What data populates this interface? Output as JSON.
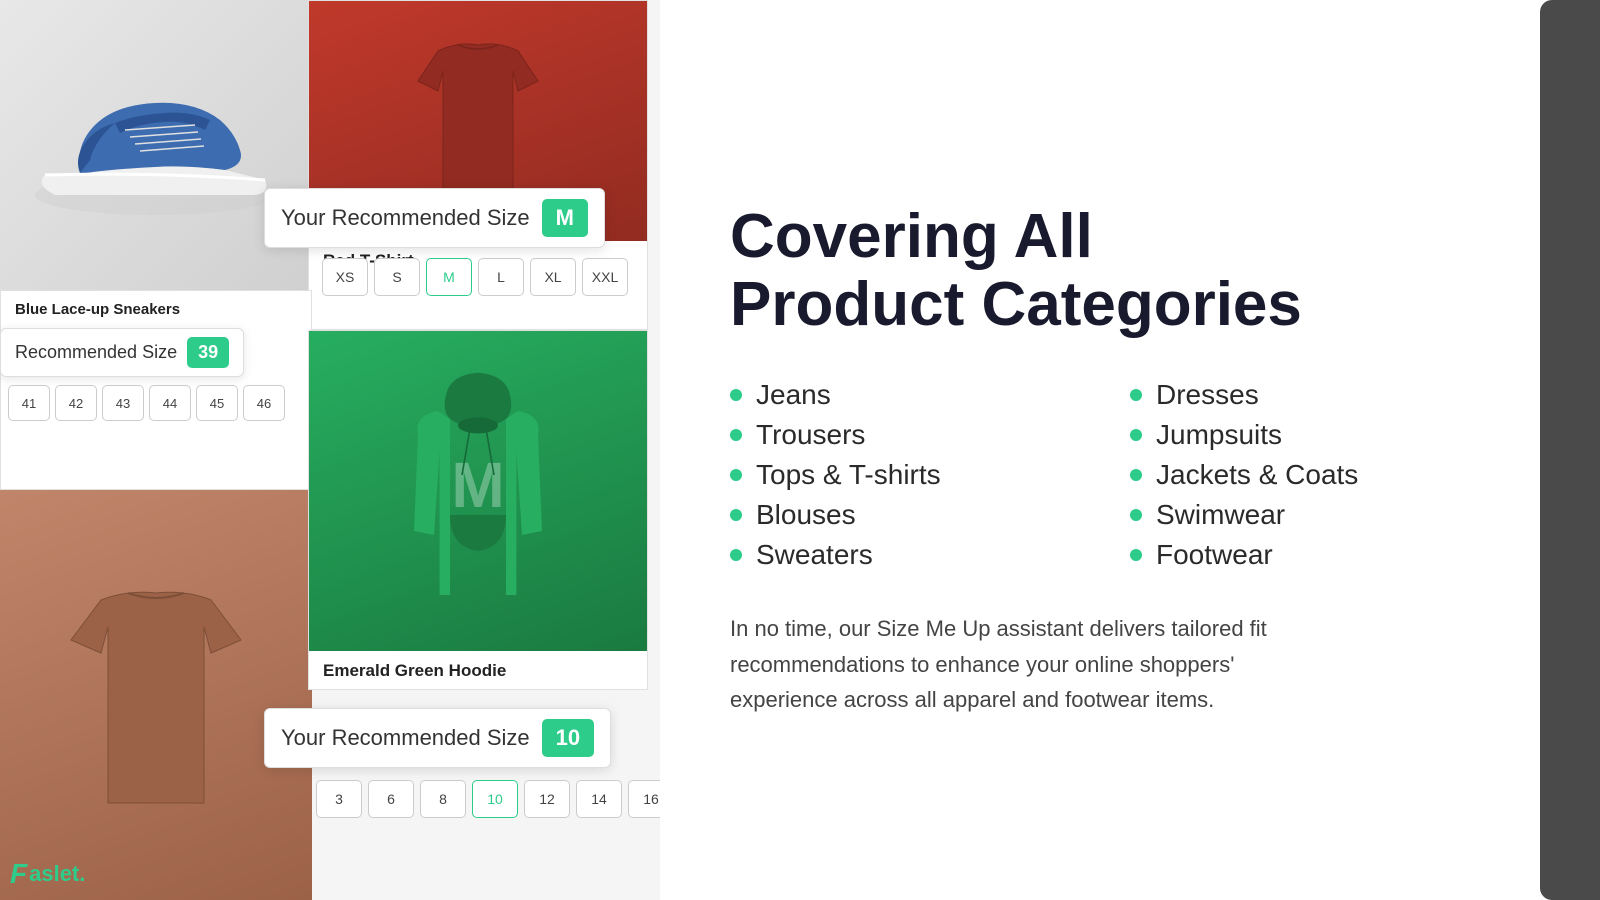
{
  "left": {
    "shoe_title": "Blue Lace-up Sneakers",
    "tshirt_title": "Red T-Shirt",
    "tshirt_rec_label": "Your Recommended Size",
    "tshirt_rec_size": "M",
    "tshirt_sizes": [
      "XS",
      "S",
      "M",
      "L",
      "XL",
      "XXL"
    ],
    "sneaker_rec_label": "Recommended Size",
    "sneaker_rec_size": "39",
    "sneaker_sizes": [
      "41",
      "42",
      "43",
      "44",
      "45",
      "46"
    ],
    "hoodie_title": "Emerald Green Hoodie",
    "hoodie_letter": "M",
    "hoodie_rec_label": "Your Recommended Size",
    "hoodie_rec_size": "10",
    "hoodie_sizes": [
      "3",
      "6",
      "8",
      "10",
      "12",
      "14",
      "16"
    ],
    "faslet_logo": "aslet."
  },
  "right": {
    "heading_line1": "Covering All",
    "heading_line2": "Product Categories",
    "categories_left": [
      "Jeans",
      "Trousers",
      "Tops & T-shirts",
      "Blouses",
      "Sweaters"
    ],
    "categories_right": [
      "Dresses",
      "Jumpsuits",
      "Jackets & Coats",
      "Swimwear",
      "Footwear"
    ],
    "description": "In no time, our Size Me Up assistant delivers tailored fit recommendations to enhance your online shoppers' experience across all apparel and footwear items."
  }
}
